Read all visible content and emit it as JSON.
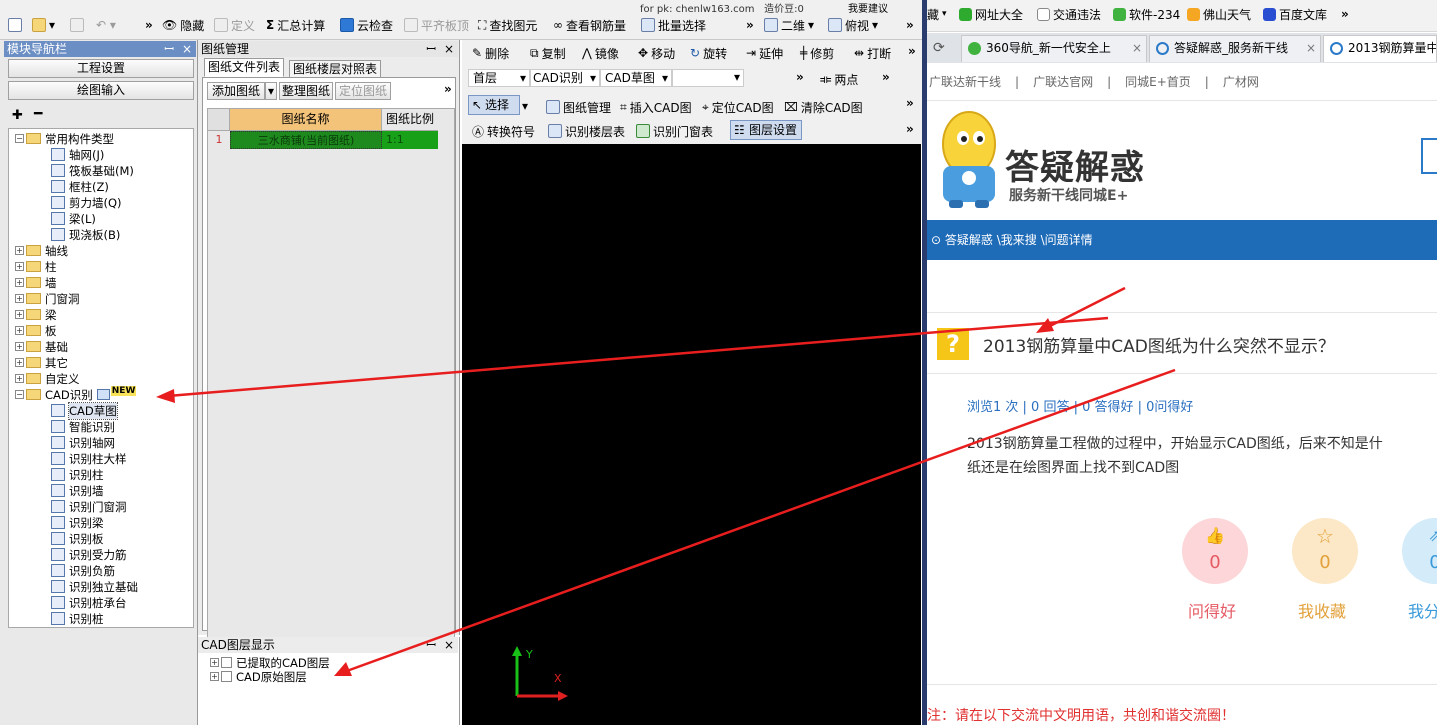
{
  "app": {
    "title_strip": "for pk: chenlw163.com",
    "build_label": "造价豆:0",
    "suggest_label": "我要建议"
  },
  "toolbar1": {
    "hide": "隐藏",
    "define": "定义",
    "sum_calc": "汇总计算",
    "cloud_check": "云检查",
    "flat_top": "平齐板顶",
    "find_elem": "查找图元",
    "view_rebar": "查看钢筋量",
    "batch_select": "批量选择",
    "view_2d": "二维",
    "view_top": "俯视",
    "more": "»"
  },
  "nav": {
    "title": "模块导航栏",
    "project_settings": "工程设置",
    "drawing_input": "绘图输入",
    "tree": [
      {
        "label": "常用构件类型",
        "level": 0,
        "kind": "folder",
        "expand": "−"
      },
      {
        "label": "轴网(J)",
        "level": 1,
        "kind": "item"
      },
      {
        "label": "筏板基础(M)",
        "level": 1,
        "kind": "item"
      },
      {
        "label": "框柱(Z)",
        "level": 1,
        "kind": "item"
      },
      {
        "label": "剪力墙(Q)",
        "level": 1,
        "kind": "item"
      },
      {
        "label": "梁(L)",
        "level": 1,
        "kind": "item"
      },
      {
        "label": "现浇板(B)",
        "level": 1,
        "kind": "item"
      },
      {
        "label": "轴线",
        "level": 0,
        "kind": "folder",
        "expand": "+"
      },
      {
        "label": "柱",
        "level": 0,
        "kind": "folder",
        "expand": "+"
      },
      {
        "label": "墙",
        "level": 0,
        "kind": "folder",
        "expand": "+"
      },
      {
        "label": "门窗洞",
        "level": 0,
        "kind": "folder",
        "expand": "+"
      },
      {
        "label": "梁",
        "level": 0,
        "kind": "folder",
        "expand": "+"
      },
      {
        "label": "板",
        "level": 0,
        "kind": "folder",
        "expand": "+"
      },
      {
        "label": "基础",
        "level": 0,
        "kind": "folder",
        "expand": "+"
      },
      {
        "label": "其它",
        "level": 0,
        "kind": "folder",
        "expand": "+"
      },
      {
        "label": "自定义",
        "level": 0,
        "kind": "folder",
        "expand": "+"
      },
      {
        "label": "CAD识别",
        "level": 0,
        "kind": "folder",
        "expand": "−",
        "badge": "NEW"
      },
      {
        "label": "CAD草图",
        "level": 1,
        "kind": "item",
        "selected": true
      },
      {
        "label": "智能识别",
        "level": 1,
        "kind": "item"
      },
      {
        "label": "识别轴网",
        "level": 1,
        "kind": "item"
      },
      {
        "label": "识别柱大样",
        "level": 1,
        "kind": "item"
      },
      {
        "label": "识别柱",
        "level": 1,
        "kind": "item"
      },
      {
        "label": "识别墙",
        "level": 1,
        "kind": "item"
      },
      {
        "label": "识别门窗洞",
        "level": 1,
        "kind": "item"
      },
      {
        "label": "识别梁",
        "level": 1,
        "kind": "item"
      },
      {
        "label": "识别板",
        "level": 1,
        "kind": "item"
      },
      {
        "label": "识别受力筋",
        "level": 1,
        "kind": "item"
      },
      {
        "label": "识别负筋",
        "level": 1,
        "kind": "item"
      },
      {
        "label": "识别独立基础",
        "level": 1,
        "kind": "item"
      },
      {
        "label": "识别桩承台",
        "level": 1,
        "kind": "item"
      },
      {
        "label": "识别桩",
        "level": 1,
        "kind": "item"
      }
    ]
  },
  "drawing_mgr": {
    "title": "图纸管理",
    "tab_files": "图纸文件列表",
    "tab_floors": "图纸楼层对照表",
    "add": "添加图纸",
    "organize": "整理图纸",
    "locate": "定位图纸",
    "col_name": "图纸名称",
    "col_scale": "图纸比例",
    "rows": [
      {
        "idx": "1",
        "name": "三水商铺(当前图纸)",
        "scale": "1:1"
      }
    ]
  },
  "cad_layers": {
    "title": "CAD图层显示",
    "items": [
      "已提取的CAD图层",
      "CAD原始图层"
    ]
  },
  "cad_toolbar": {
    "delete": "删除",
    "copy": "复制",
    "mirror": "镜像",
    "move": "移动",
    "rotate": "旋转",
    "extend": "延伸",
    "trim": "修剪",
    "break": "打断",
    "floor": "首层",
    "cad_recog": "CAD识别",
    "cad_sketch": "CAD草图",
    "two_points": "两点",
    "select": "选择",
    "drawing_mgr": "图纸管理",
    "insert_cad": "插入CAD图",
    "locate_cad": "定位CAD图",
    "clear_cad": "清除CAD图",
    "convert_symbol": "转换符号",
    "recog_floor_table": "识别楼层表",
    "recog_door_table": "识别门窗表",
    "layer_settings": "图层设置",
    "axis_y": "Y",
    "axis_x": "X"
  },
  "browser": {
    "bookmarks": [
      "藏",
      "网址大全",
      "交通违法",
      "软件-234",
      "佛山天气",
      "百度文库"
    ],
    "tabs": [
      "360导航_新一代安全上",
      "答疑解惑_服务新干线",
      "2013钢筋算量中"
    ],
    "links": [
      "广联达新干线",
      "广联达官网",
      "同城E+首页",
      "广材网"
    ],
    "logo_title": "答疑解惑",
    "logo_sub": "服务新干线同城E+",
    "breadcrumb": "答疑解惑 \\我来搜 \\问题详情",
    "question_title": "2013钢筋算量中CAD图纸为什么突然不显示？",
    "stats": "浏览1 次 | 0 回答 | 0 答得好 | 0问得好",
    "body_line1": "2013钢筋算量工程做的过程中，开始显示CAD图纸，后来不知是什",
    "body_line2": "纸还是在绘图界面上找不到CAD图",
    "btn_good_count": "0",
    "btn_good_label": "问得好",
    "btn_fav_count": "0",
    "btn_fav_label": "我收藏",
    "btn_share_count": "0",
    "btn_share_label": "我分",
    "notice": "注：请在以下交流中文明用语，共创和谐交流圈！"
  }
}
